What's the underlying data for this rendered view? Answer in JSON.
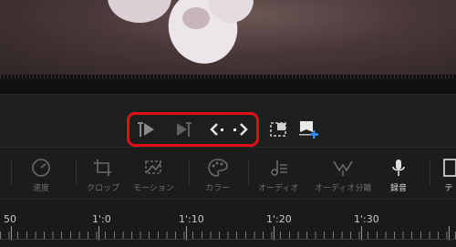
{
  "playback": {
    "buttons": [
      "play-from-start",
      "play-range",
      "jump-back",
      "jump-forward",
      "snapshot",
      "add-marker"
    ],
    "highlight_color": "#e0101a"
  },
  "tools": [
    {
      "label": "速度",
      "icon": "speed-gauge-icon"
    },
    {
      "label": "クロップ",
      "icon": "crop-icon"
    },
    {
      "label": "モーション",
      "icon": "motion-icon"
    },
    {
      "label": "カラー",
      "icon": "palette-icon"
    },
    {
      "label": "オーディオ",
      "icon": "audio-icon"
    },
    {
      "label": "オーディオ分離",
      "icon": "audio-split-icon"
    },
    {
      "label": "録音",
      "icon": "microphone-icon"
    },
    {
      "label": "テ",
      "icon": "text-icon"
    }
  ],
  "ruler": {
    "labels": [
      "50",
      "1':0",
      "1':10",
      "1':20",
      "1':30"
    ]
  }
}
